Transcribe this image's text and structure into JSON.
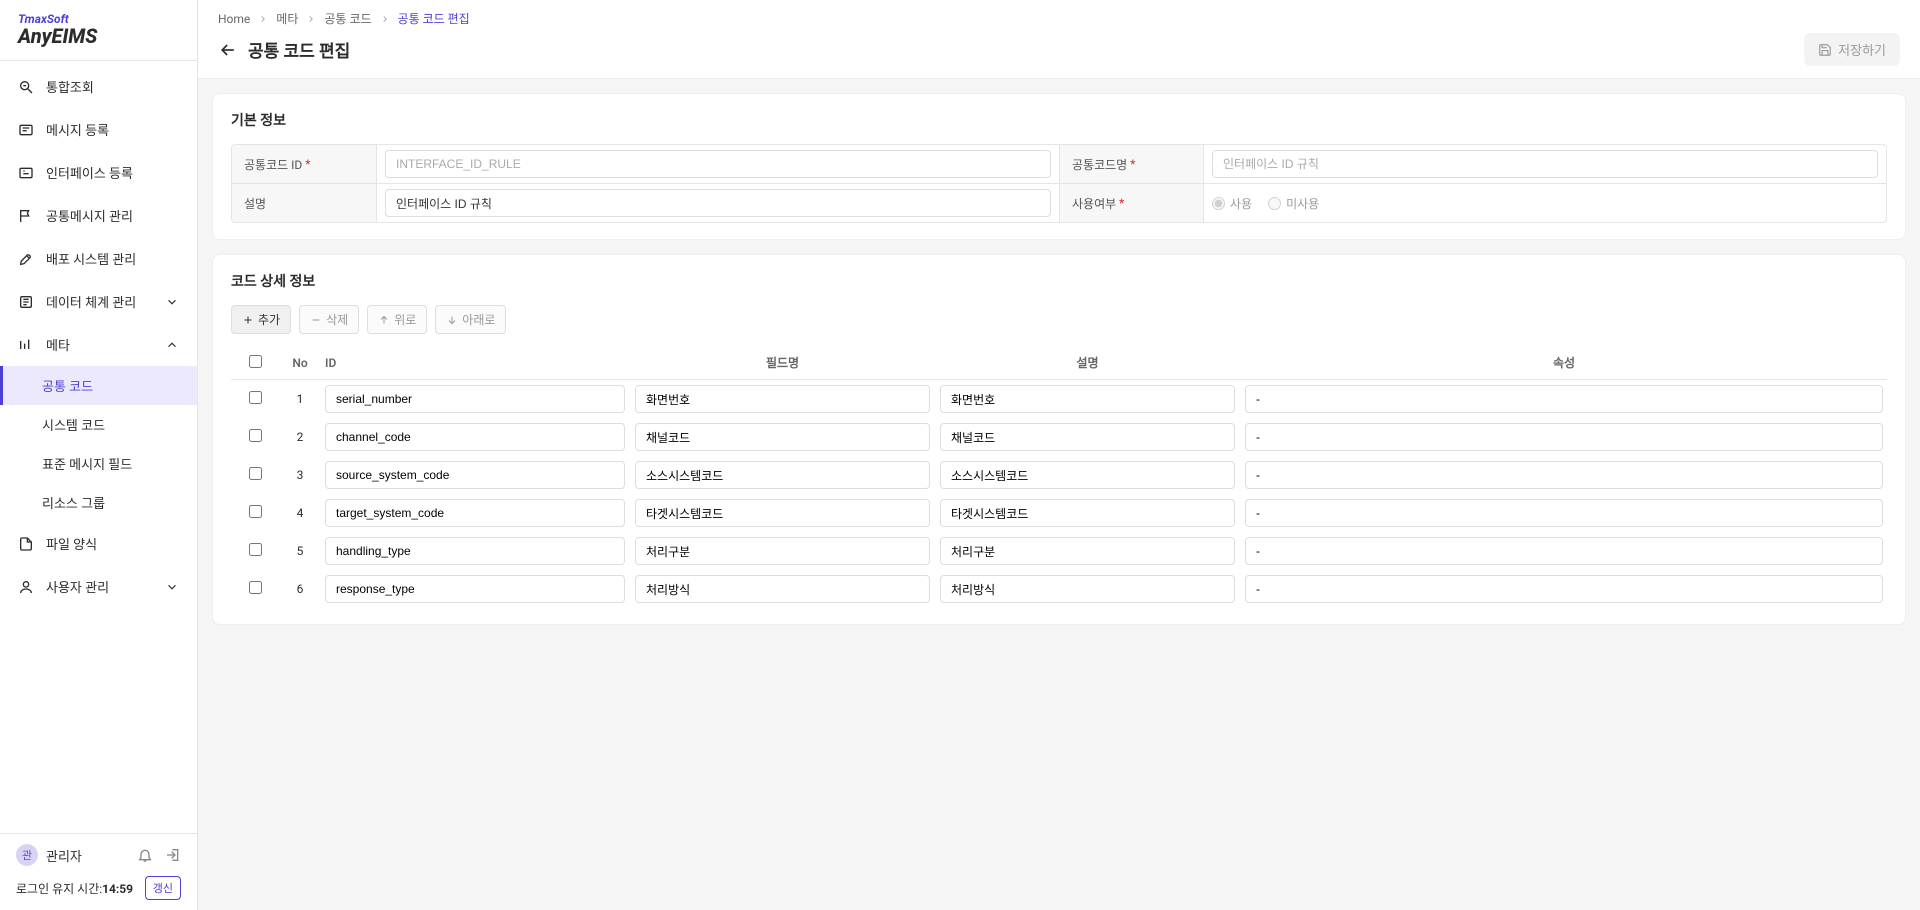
{
  "brand": {
    "top": "TmaxSoft",
    "main": "AnyEIMS"
  },
  "sidebar": {
    "items": [
      {
        "label": "통합조회"
      },
      {
        "label": "메시지 등록"
      },
      {
        "label": "인터페이스 등록"
      },
      {
        "label": "공통메시지 관리"
      },
      {
        "label": "배포 시스템 관리"
      },
      {
        "label": "데이터 체계 관리"
      },
      {
        "label": "메타"
      },
      {
        "label": "파일 양식"
      },
      {
        "label": "사용자 관리"
      }
    ],
    "meta_children": [
      {
        "label": "공통 코드"
      },
      {
        "label": "시스템 코드"
      },
      {
        "label": "표준 메시지 필드"
      },
      {
        "label": "리소스 그룹"
      }
    ]
  },
  "footer": {
    "avatar": "관",
    "username": "관리자",
    "session_label": "로그인 유지 시간:",
    "session_time": "14:59",
    "refresh": "갱신"
  },
  "breadcrumb": {
    "home": "Home",
    "meta": "메타",
    "common": "공통 코드",
    "current": "공통 코드 편집"
  },
  "page": {
    "title": "공통 코드 편집",
    "save": "저장하기"
  },
  "section1": {
    "title": "기본 정보",
    "labels": {
      "id": "공통코드 ID",
      "name": "공통코드명",
      "desc": "설명",
      "use": "사용여부"
    },
    "values": {
      "id": "INTERFACE_ID_RULE",
      "name": "인터페이스 ID 규칙",
      "desc": "인터페이스 ID 규칙"
    },
    "radio": {
      "yes": "사용",
      "no": "미사용"
    }
  },
  "section2": {
    "title": "코드 상세 정보",
    "buttons": {
      "add": "추가",
      "del": "삭제",
      "up": "위로",
      "down": "아래로"
    },
    "columns": {
      "no": "No",
      "id": "ID",
      "field": "필드명",
      "desc": "설명",
      "attr": "속성"
    },
    "rows": [
      {
        "no": "1",
        "id": "serial_number",
        "field": "화면번호",
        "desc": "화면번호",
        "attr": "-"
      },
      {
        "no": "2",
        "id": "channel_code",
        "field": "채널코드",
        "desc": "채널코드",
        "attr": "-"
      },
      {
        "no": "3",
        "id": "source_system_code",
        "field": "소스시스템코드",
        "desc": "소스시스템코드",
        "attr": "-"
      },
      {
        "no": "4",
        "id": "target_system_code",
        "field": "타겟시스템코드",
        "desc": "타겟시스템코드",
        "attr": "-"
      },
      {
        "no": "5",
        "id": "handling_type",
        "field": "처리구분",
        "desc": "처리구분",
        "attr": "-"
      },
      {
        "no": "6",
        "id": "response_type",
        "field": "처리방식",
        "desc": "처리방식",
        "attr": "-"
      }
    ]
  }
}
